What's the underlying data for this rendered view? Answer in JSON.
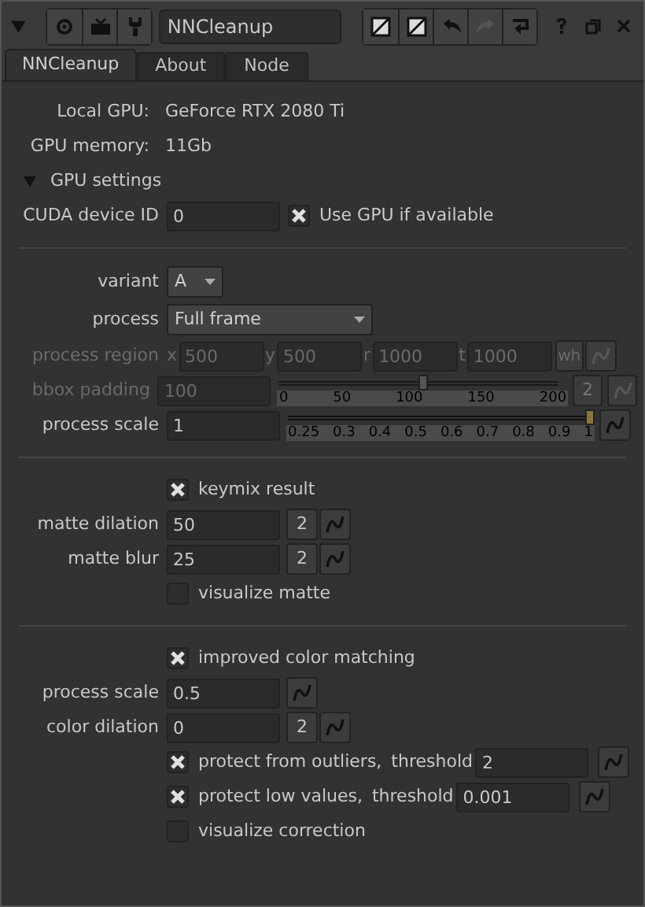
{
  "toolbar": {
    "node_name": "NNCleanup"
  },
  "tabs": [
    {
      "label": "NNCleanup",
      "selected": true
    },
    {
      "label": "About",
      "selected": false
    },
    {
      "label": "Node",
      "selected": false
    }
  ],
  "info": [
    {
      "label": "Local GPU:",
      "value": "GeForce RTX 2080 Ti"
    },
    {
      "label": "GPU memory:",
      "value": "11Gb"
    }
  ],
  "group": {
    "label": "GPU settings",
    "expanded": true
  },
  "rows": [
    {
      "kind": "input_check",
      "label": "CUDA device ID",
      "value": "0",
      "check_label": "Use GPU if available",
      "checked": true
    },
    {
      "kind": "divider"
    },
    {
      "kind": "dropdown",
      "label": "variant",
      "value": "A",
      "wide": false
    },
    {
      "kind": "dropdown",
      "label": "process",
      "value": "Full frame",
      "wide": true
    },
    {
      "kind": "region",
      "label": "process region",
      "disabled": true,
      "fields": [
        {
          "prefix": "x",
          "value": "500"
        },
        {
          "prefix": "y",
          "value": "500"
        },
        {
          "prefix": "r",
          "value": "1000"
        },
        {
          "prefix": "t",
          "value": "1000"
        }
      ],
      "button": "wh"
    },
    {
      "kind": "slider",
      "label": "bbox padding",
      "value": "100",
      "disabled": true,
      "level": 0.5,
      "ticks": [
        "0",
        "50",
        "100",
        "150",
        "200"
      ],
      "views": "2"
    },
    {
      "kind": "slider",
      "label": "process scale",
      "value": "1",
      "disabled": false,
      "level": 1,
      "ticks": [
        "0.25",
        "0.3",
        "0.4",
        "0.5",
        "0.6",
        "0.7",
        "0.8",
        "0.9",
        "1"
      ]
    },
    {
      "kind": "divider"
    },
    {
      "kind": "checkbox",
      "label": "keymix result",
      "checked": true
    },
    {
      "kind": "input",
      "label": "matte dilation",
      "value": "50",
      "views": "2"
    },
    {
      "kind": "input",
      "label": "matte blur",
      "value": "25",
      "views": "2"
    },
    {
      "kind": "checkbox",
      "label": "visualize matte",
      "checked": false
    },
    {
      "kind": "divider"
    },
    {
      "kind": "checkbox",
      "label": "improved color matching",
      "checked": true
    },
    {
      "kind": "input",
      "label": "process scale",
      "value": "0.5"
    },
    {
      "kind": "input",
      "label": "color dilation",
      "value": "0",
      "views": "2"
    },
    {
      "kind": "check_threshold",
      "label": "protect from outliers,",
      "checked": true,
      "threshold_label": "threshold",
      "value": "2"
    },
    {
      "kind": "check_threshold",
      "label": "protect low values,",
      "checked": true,
      "threshold_label": "threshold",
      "value": "0.001"
    },
    {
      "kind": "checkbox",
      "label": "visualize correction",
      "checked": false
    }
  ]
}
